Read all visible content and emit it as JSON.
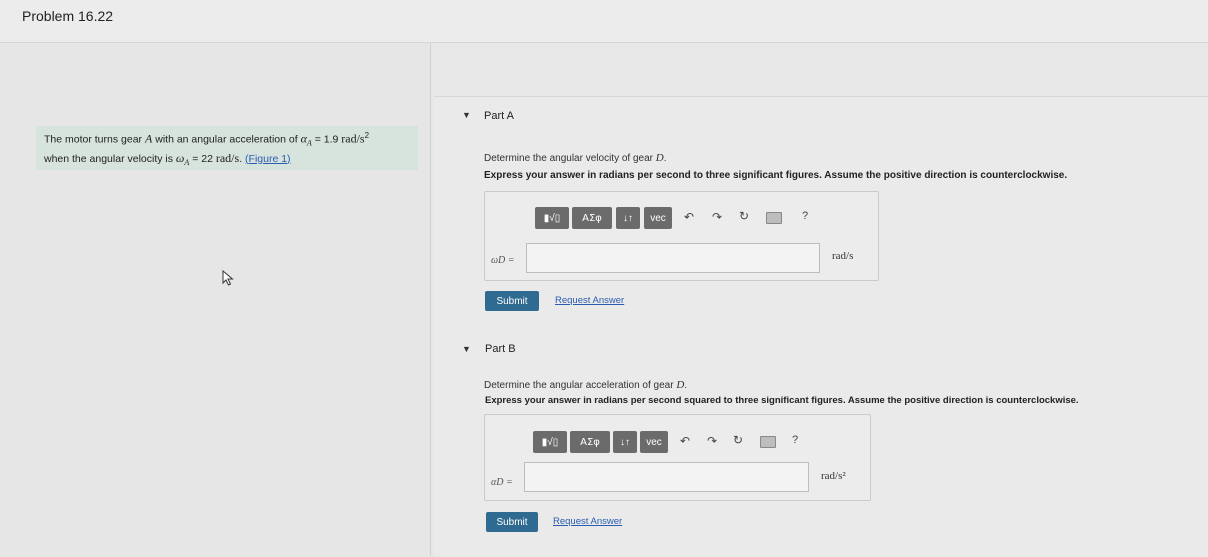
{
  "header": {
    "title": "Problem 16.22"
  },
  "statement": {
    "line1_prefix": "The motor turns gear ",
    "gear": "A",
    "line1_mid": " with an angular acceleration of ",
    "alpha_sym": "α",
    "alpha_sub": "A",
    "alpha_val": " = 1.9 ",
    "alpha_unit": "rad/s",
    "alpha_unit_sup": "2",
    "line2_prefix": "when the angular velocity is ",
    "omega_sym": "ω",
    "omega_sub": "A",
    "omega_val": " = 22 ",
    "omega_unit": "rad/s",
    "omega_end": ". ",
    "figure_link": "(Figure 1)"
  },
  "partA": {
    "label": "Part A",
    "question_prefix": "Determine the angular velocity of gear ",
    "question_var": "D",
    "question_end": ".",
    "instruction": "Express your answer in radians per second to three significant figures. Assume the positive direction is counterclockwise.",
    "toolbar": {
      "templates": "▮√▯",
      "greek": "ΑΣφ",
      "arrows": "↓↑",
      "vec": "vec",
      "help": "?"
    },
    "var_label": "ωD =",
    "unit": "rad/s",
    "submit": "Submit",
    "request": "Request Answer"
  },
  "partB": {
    "label": "Part B",
    "question_prefix": "Determine the angular acceleration of gear ",
    "question_var": "D",
    "question_end": ".",
    "instruction": "Express your answer in radians per second squared to three significant figures. Assume the positive direction is counterclockwise.",
    "toolbar": {
      "templates": "▮√▯",
      "greek": "ΑΣφ",
      "arrows": "↓↑",
      "vec": "vec",
      "help": "?"
    },
    "var_label": "αD =",
    "unit": "rad/s²",
    "submit": "Submit",
    "request": "Request Answer"
  }
}
